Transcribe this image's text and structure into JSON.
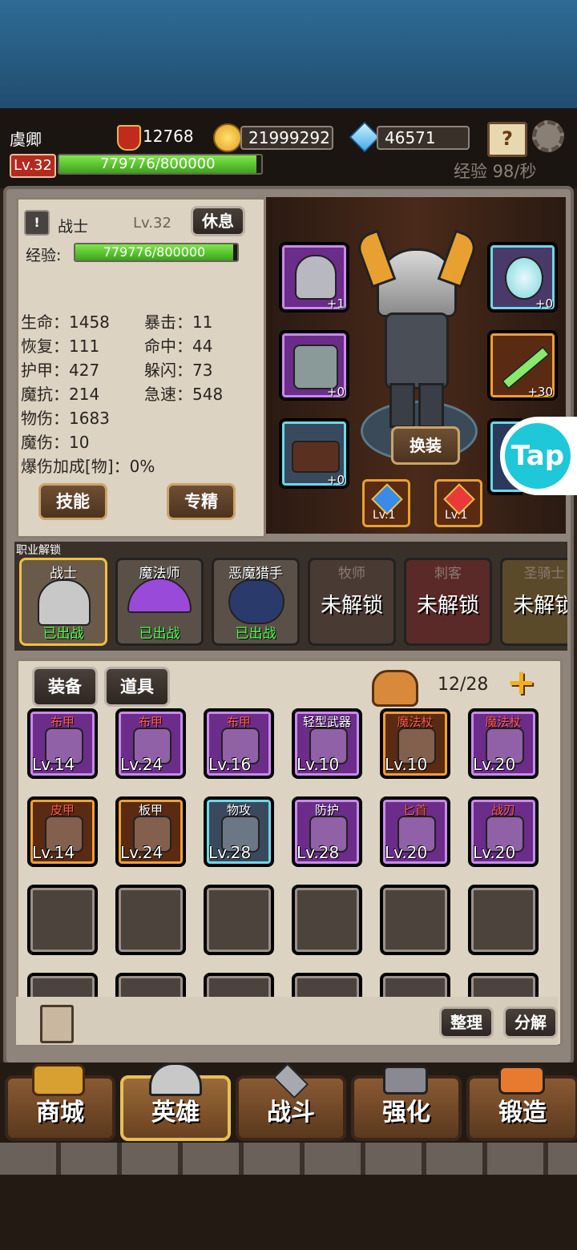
{
  "header": {
    "player_name": "虞卿",
    "level_badge": "Lv.32",
    "power": "12768",
    "gold": "21999292",
    "gems": "46571",
    "exp_text": "779776/800000",
    "exp_fraction": 0.975,
    "exp_rate": "经验 98/秒"
  },
  "hero": {
    "class_name": "战士",
    "level": "Lv.32",
    "rest_label": "休息",
    "exp_label": "经验:",
    "exp_text": "779776/800000",
    "stats_left": [
      "生命：1458",
      "恢复：111",
      "护甲：427",
      "魔抗：214",
      "物伤：1683",
      "魔伤：10",
      "爆伤加成[物]：0%"
    ],
    "stats_right": [
      "暴击：11",
      "命中：44",
      "躲闪：73",
      "急速：548"
    ],
    "skill_label": "技能",
    "mastery_label": "专精",
    "change_outfit_label": "换装",
    "slots": {
      "helmet": "+1",
      "armor": "+0",
      "boots": "+0",
      "accessory": "+0",
      "weapon": "+30"
    },
    "gem_slots": [
      "Lv.1",
      "Lv.1"
    ]
  },
  "tap_badge": "Tap",
  "jobs": {
    "title": "职业解锁",
    "items": [
      {
        "name": "战士",
        "status": "已出战"
      },
      {
        "name": "魔法师",
        "status": "已出战"
      },
      {
        "name": "恶魔猎手",
        "status": "已出战"
      },
      {
        "name": "牧师",
        "status": "未解锁"
      },
      {
        "name": "刺客",
        "status": "未解锁"
      },
      {
        "name": "圣骑士",
        "status": "未解锁"
      }
    ]
  },
  "inventory": {
    "tab_equipment": "装备",
    "tab_items": "道具",
    "capacity": "12/28",
    "sort_label": "整理",
    "decompose_label": "分解",
    "items": [
      {
        "type": "布甲",
        "level": "Lv.14",
        "rarity": "purple",
        "red": true
      },
      {
        "type": "布甲",
        "level": "Lv.24",
        "rarity": "purple",
        "red": true
      },
      {
        "type": "布甲",
        "level": "Lv.16",
        "rarity": "purple",
        "red": true
      },
      {
        "type": "轻型武器",
        "level": "Lv.10",
        "rarity": "purple",
        "red": false
      },
      {
        "type": "魔法杖",
        "level": "Lv.10",
        "rarity": "orange",
        "red": true
      },
      {
        "type": "魔法杖",
        "level": "Lv.20",
        "rarity": "purple",
        "red": true
      },
      {
        "type": "皮甲",
        "level": "Lv.14",
        "rarity": "orange",
        "red": true
      },
      {
        "type": "板甲",
        "level": "Lv.24",
        "rarity": "orange",
        "red": false
      },
      {
        "type": "物攻",
        "level": "Lv.28",
        "rarity": "cyan",
        "red": false
      },
      {
        "type": "防护",
        "level": "Lv.28",
        "rarity": "purple",
        "red": false
      },
      {
        "type": "匕首",
        "level": "Lv.20",
        "rarity": "purple",
        "red": true
      },
      {
        "type": "战刃",
        "level": "Lv.20",
        "rarity": "purple",
        "red": true
      }
    ]
  },
  "nav": [
    "商城",
    "英雄",
    "战斗",
    "强化",
    "锻造"
  ]
}
